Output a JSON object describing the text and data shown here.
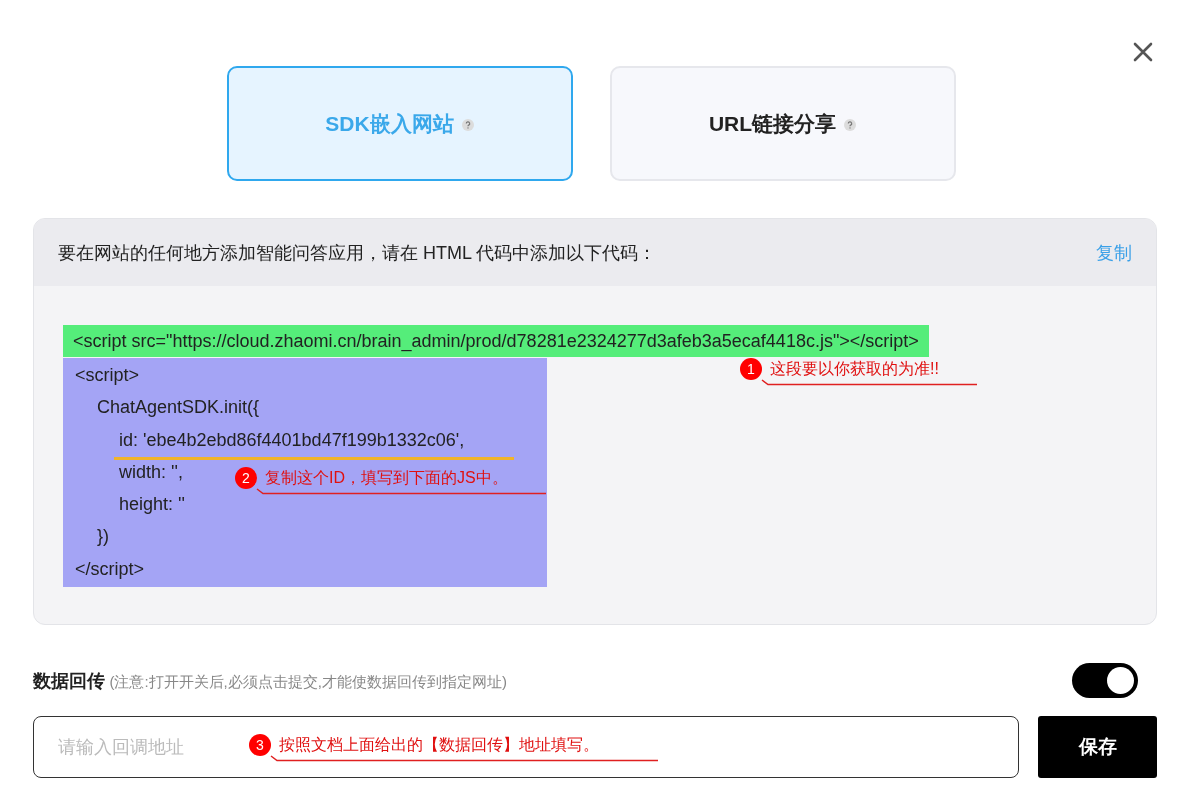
{
  "tabs": [
    {
      "label": "SDK嵌入网站",
      "selected": true
    },
    {
      "label": "URL链接分享",
      "selected": false
    }
  ],
  "code_panel": {
    "instruction": "要在网站的任何地方添加智能问答应用，请在 HTML 代码中添加以下代码：",
    "copy_link": "复制",
    "script_tag": "<script src=\"https://cloud.zhaomi.cn/brain_admin/prod/d78281e2324277d3afeb3a5ecaf4418c.js\"></script>",
    "init_lines": [
      {
        "text": "<script>",
        "children": [
          {
            "text": "ChatAgentSDK.init({",
            "children": [
              {
                "text": "id: 'ebe4b2ebd86f4401bd47f199b1332c06',"
              },
              {
                "text": "width: '',"
              },
              {
                "text": "height: ''"
              }
            ]
          },
          {
            "text": "})"
          }
        ]
      },
      {
        "text": "</script>"
      }
    ],
    "annotations": [
      {
        "number": "1",
        "text": "这段要以你获取的为准!!"
      },
      {
        "number": "2",
        "text": "复制这个ID，填写到下面的JS中。"
      }
    ]
  },
  "data_callback": {
    "label": "数据回传",
    "note": "(注意:打开开关后,必须点击提交,才能使数据回传到指定网址)",
    "on": true,
    "placeholder": "请输入回调地址",
    "annotation": {
      "number": "3",
      "text": "按照文档上面给出的【数据回传】地址填写。"
    },
    "save_button": "保存"
  }
}
